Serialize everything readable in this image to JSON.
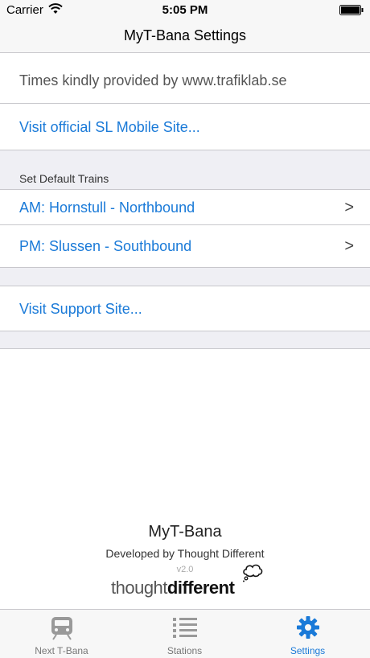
{
  "status": {
    "carrier": "Carrier",
    "time": "5:05 PM",
    "icons": [
      "wifi-icon",
      "battery-icon"
    ]
  },
  "nav": {
    "title": "MyT-Bana Settings"
  },
  "info": {
    "credit": "Times kindly provided by www.trafiklab.se",
    "sl_link": "Visit official SL Mobile Site..."
  },
  "default_trains": {
    "header": "Set Default Trains",
    "items": [
      {
        "label": "AM: Hornstull - Northbound",
        "chevron": ">"
      },
      {
        "label": "PM: Slussen - Southbound",
        "chevron": ">"
      }
    ]
  },
  "support": {
    "link": "Visit Support Site..."
  },
  "footer": {
    "app_name": "MyT-Bana",
    "developer": "Developed by Thought Different",
    "version": "v2.0",
    "logo_thin": "thought",
    "logo_bold": "different"
  },
  "tabs": [
    {
      "label": "Next T-Bana",
      "icon": "train-icon",
      "active": false
    },
    {
      "label": "Stations",
      "icon": "list-icon",
      "active": false
    },
    {
      "label": "Settings",
      "icon": "gear-icon",
      "active": true
    }
  ],
  "colors": {
    "accent": "#1a7ad8",
    "background": "#efeff4",
    "bar": "#f7f7f7"
  }
}
